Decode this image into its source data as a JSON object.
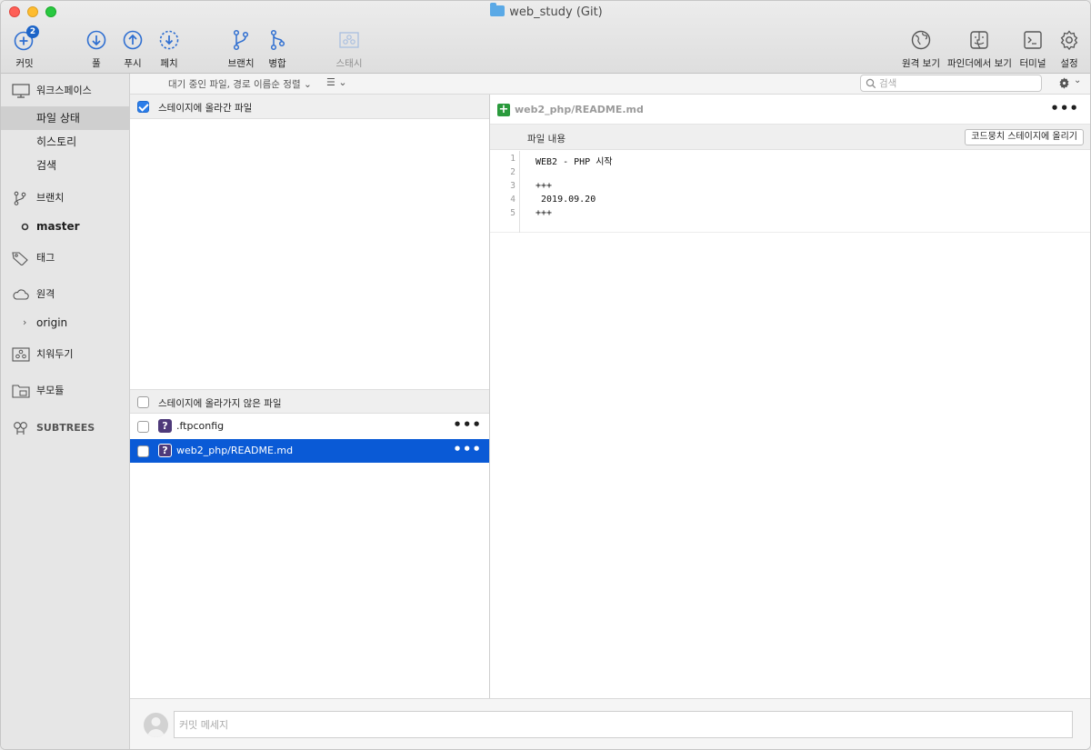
{
  "window": {
    "title": "web_study (Git)"
  },
  "toolbar": {
    "commit_label": "커밋",
    "commit_badge": "2",
    "pull_label": "풀",
    "push_label": "푸시",
    "fetch_label": "페치",
    "branch_label": "브랜치",
    "merge_label": "병합",
    "stash_label": "스태시",
    "remote_view_label": "원격 보기",
    "finder_label": "파인더에서 보기",
    "terminal_label": "터미널",
    "settings_label": "설정"
  },
  "sidebar": {
    "workspace": "워크스페이스",
    "file_status": "파일 상태",
    "history": "히스토리",
    "search": "검색",
    "branches": "브랜치",
    "current_branch": "master",
    "tags": "태그",
    "remotes": "원격",
    "remote_origin": "origin",
    "stashes": "치워두기",
    "submodules": "부모듈",
    "subtrees": "SUBTREES"
  },
  "filterbar": {
    "sort_label": "대기 중인 파일, 경로 이름순 정렬 ⌄",
    "view_mode": "☰ ⌄",
    "search_placeholder": "검색"
  },
  "staged": {
    "header": "스테이지에 올라간 파일",
    "checked": true,
    "files": []
  },
  "unstaged": {
    "header": "스테이지에 올라가지 않은 파일",
    "checked": false,
    "files": [
      {
        "name": ".ftpconfig",
        "status": "?",
        "selected": false
      },
      {
        "name": "web2_php/README.md",
        "status": "?",
        "selected": true
      }
    ]
  },
  "diff": {
    "file": "web2_php/README.md",
    "hunk_title": "파일 내용",
    "stage_hunk_button": "코드뭉치 스테이지에 올리기",
    "lines": [
      {
        "num": "1",
        "text": "WEB2 - PHP 시작"
      },
      {
        "num": "2",
        "text": ""
      },
      {
        "num": "3",
        "text": "+++"
      },
      {
        "num": "4",
        "text": " 2019.09.20"
      },
      {
        "num": "5",
        "text": "+++"
      }
    ]
  },
  "commit": {
    "placeholder": "커밋 메세지"
  },
  "colors": {
    "selection": "#0a5ad6",
    "badge": "#1c64c8",
    "toolbar_icon": "#2f6fd1",
    "added": "#2a9a3c",
    "untracked": "#4e3a7a"
  }
}
